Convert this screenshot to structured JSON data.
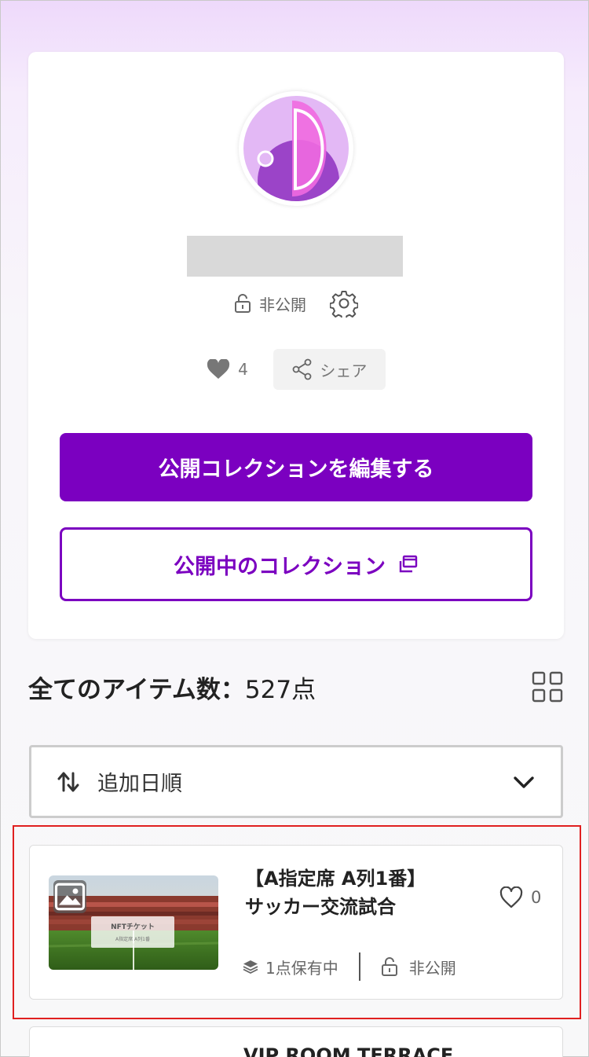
{
  "profile": {
    "privacy_label": "非公開",
    "likes_count": "4",
    "share_label": "シェア",
    "edit_button_label": "公開コレクションを編集する",
    "public_collection_label": "公開中のコレクション"
  },
  "items_header": {
    "title_prefix": "全てのアイテム数：",
    "count": "527点"
  },
  "sort": {
    "selected": "追加日順"
  },
  "items": [
    {
      "title_line1": "【A指定席 A列1番】",
      "title_line2": "サッカー交流試合",
      "likes": "0",
      "owned": "1点保有中",
      "privacy": "非公開",
      "thumb_label": "NFTチケット",
      "thumb_sub": "A指定席 A列1番"
    },
    {
      "title_line1": "VIP ROOM TERRACE"
    }
  ],
  "colors": {
    "accent": "#7b00c0",
    "highlight": "#e02020"
  },
  "icons": [
    "lock-icon",
    "gear-icon",
    "heart-icon",
    "share-icon",
    "external-window-icon",
    "grid-view-icon",
    "sort-icon",
    "chevron-down-icon",
    "image-icon",
    "heart-outline-icon",
    "stack-icon"
  ]
}
